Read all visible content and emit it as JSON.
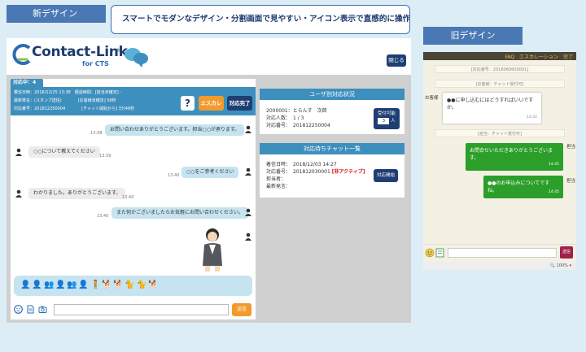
{
  "labels": {
    "new_design": "新デザイン",
    "old_design": "旧デザイン",
    "callout": "スマートでモダンなデザイン・分割画面で見やすい・アイコン表示で直感的に操作。"
  },
  "header": {
    "logo_main": "Contact-Link",
    "logo_reg": "®",
    "logo_sub": "for CTS",
    "close_label": "閉じる"
  },
  "chat": {
    "tab_label": "対応中：4",
    "info_rows": [
      "着信日時：2016/12/25 13:38　経過時間：[担当未確定] -",
      "最新発言：(スタンプ送信)　　　　[お客様未確定] 58秒",
      "対応番号：201812250004　　　　[チャット開始から] 3分46秒"
    ],
    "help_label": "?",
    "escalate_label": "エスカレ",
    "complete_label": "対応完了",
    "messages": [
      {
        "from": "op",
        "text": "お問い合わせありがとうございます。担当○○が承ります。",
        "time": "13:38"
      },
      {
        "from": "cu",
        "text": "○○について教えてください",
        "time": "13:39"
      },
      {
        "from": "op",
        "text": "○○をご参考ください",
        "time": "13:40"
      },
      {
        "from": "cu",
        "text": "わかりました。ありがとうございます。",
        "time": "13:40"
      },
      {
        "from": "op",
        "text": "また何かございましたらお気軽にお問い合わせください。",
        "time": "13:40"
      }
    ],
    "send_label": "送信"
  },
  "user_status": {
    "title": "ユーザ別対応状況",
    "id_line": "2000001：とらんす　次郎",
    "count_line": "対応人数：　1 / 3",
    "number_line": "対応番号：　201812250004",
    "accept_label": "受付可能",
    "accept_value": "3",
    "accept_unit": "人"
  },
  "waiting": {
    "title": "対応待ちチャット一覧",
    "arrival": "着信日時：　2018/12/03 14:27",
    "number": "対応番号：　201812030001",
    "inactive": "[非アクティブ]",
    "staff": "担当者：",
    "last": "最新発言：",
    "start_label": "対応開始"
  },
  "old": {
    "links": "FAQ　エスカレーション　完了",
    "sys1": "[対応番号：2018060600001]",
    "sys2": "[お客様：チャット受付可]",
    "customer_label": "お客様",
    "customer_msg": "●●に申し込むにはどうすればいいですか。",
    "customer_time": "14:42",
    "sys3": "[担当：チャット受付可]",
    "agent_label1": "担当",
    "agent_msg1": "お問合せいただきありがとうございます。",
    "agent_time1": "14:45",
    "agent_label2": "担当",
    "agent_msg2": "●●のお申込みについてですね。",
    "agent_time2": "14:45",
    "send_label": "送信",
    "zoom": "100%"
  }
}
